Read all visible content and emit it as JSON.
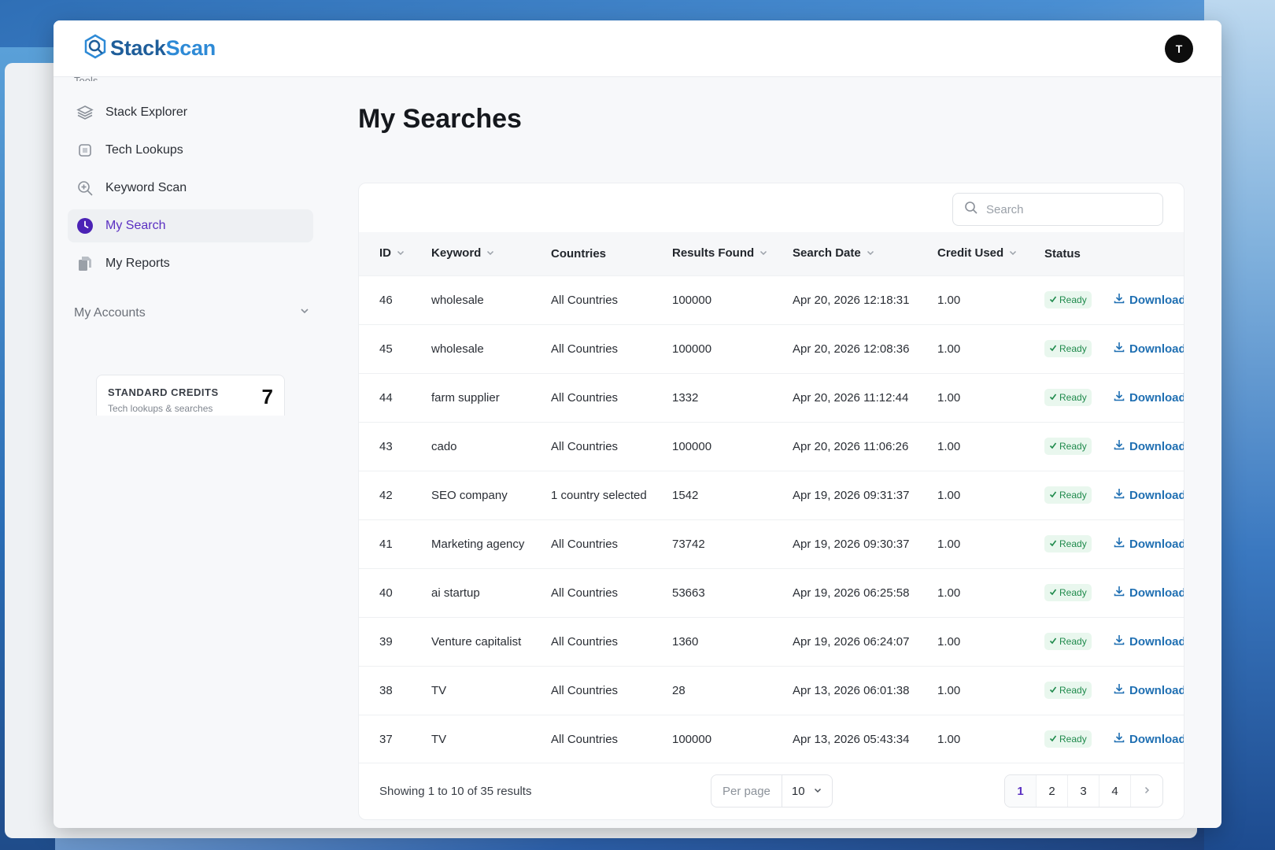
{
  "app": {
    "brand_part1": "Stack",
    "brand_part2": "Scan",
    "avatar_initial": "T"
  },
  "sidebar": {
    "section_label": "Tools",
    "items": [
      {
        "label": "Stack Explorer",
        "icon": "layers-icon"
      },
      {
        "label": "Tech Lookups",
        "icon": "chip-icon"
      },
      {
        "label": "Keyword Scan",
        "icon": "zoom-in-icon"
      },
      {
        "label": "My Search",
        "icon": "clock-icon",
        "active": true
      },
      {
        "label": "My Reports",
        "icon": "documents-icon"
      }
    ],
    "accounts_label": "My Accounts",
    "credits": {
      "title": "STANDARD CREDITS",
      "subtitle": "Tech lookups & searches",
      "count": "7"
    }
  },
  "main": {
    "title": "My Searches",
    "search_placeholder": "Search",
    "columns": [
      "ID",
      "Keyword",
      "Countries",
      "Results Found",
      "Search Date",
      "Credit Used",
      "Status"
    ],
    "rows": [
      {
        "id": "46",
        "keyword": "wholesale",
        "countries": "All Countries",
        "results": "100000",
        "date": "Apr 20, 2026 12:18:31",
        "credit": "1.00",
        "status": "Ready",
        "action": "Download"
      },
      {
        "id": "45",
        "keyword": "wholesale",
        "countries": "All Countries",
        "results": "100000",
        "date": "Apr 20, 2026 12:08:36",
        "credit": "1.00",
        "status": "Ready",
        "action": "Download"
      },
      {
        "id": "44",
        "keyword": "farm supplier",
        "countries": "All Countries",
        "results": "1332",
        "date": "Apr 20, 2026 11:12:44",
        "credit": "1.00",
        "status": "Ready",
        "action": "Download"
      },
      {
        "id": "43",
        "keyword": "cado",
        "countries": "All Countries",
        "results": "100000",
        "date": "Apr 20, 2026 11:06:26",
        "credit": "1.00",
        "status": "Ready",
        "action": "Download"
      },
      {
        "id": "42",
        "keyword": "SEO company",
        "countries": "1 country selected",
        "results": "1542",
        "date": "Apr 19, 2026 09:31:37",
        "credit": "1.00",
        "status": "Ready",
        "action": "Download"
      },
      {
        "id": "41",
        "keyword": "Marketing agency",
        "countries": "All Countries",
        "results": "73742",
        "date": "Apr 19, 2026 09:30:37",
        "credit": "1.00",
        "status": "Ready",
        "action": "Download"
      },
      {
        "id": "40",
        "keyword": "ai startup",
        "countries": "All Countries",
        "results": "53663",
        "date": "Apr 19, 2026 06:25:58",
        "credit": "1.00",
        "status": "Ready",
        "action": "Download"
      },
      {
        "id": "39",
        "keyword": "Venture capitalist",
        "countries": "All Countries",
        "results": "1360",
        "date": "Apr 19, 2026 06:24:07",
        "credit": "1.00",
        "status": "Ready",
        "action": "Download"
      },
      {
        "id": "38",
        "keyword": "TV",
        "countries": "All Countries",
        "results": "28",
        "date": "Apr 13, 2026 06:01:38",
        "credit": "1.00",
        "status": "Ready",
        "action": "Download"
      },
      {
        "id": "37",
        "keyword": "TV",
        "countries": "All Countries",
        "results": "100000",
        "date": "Apr 13, 2026 05:43:34",
        "credit": "1.00",
        "status": "Ready",
        "action": "Download"
      }
    ],
    "footer": {
      "showing": "Showing 1 to 10 of 35 results",
      "per_page_label": "Per page",
      "per_page_value": "10",
      "pages": [
        "1",
        "2",
        "3",
        "4"
      ],
      "current_page": "1"
    }
  },
  "colors": {
    "accent": "#5a2fc2",
    "brand": "#1f5e9a",
    "status_ready": "#1f8a4c",
    "download_link": "#1f6fb2"
  }
}
